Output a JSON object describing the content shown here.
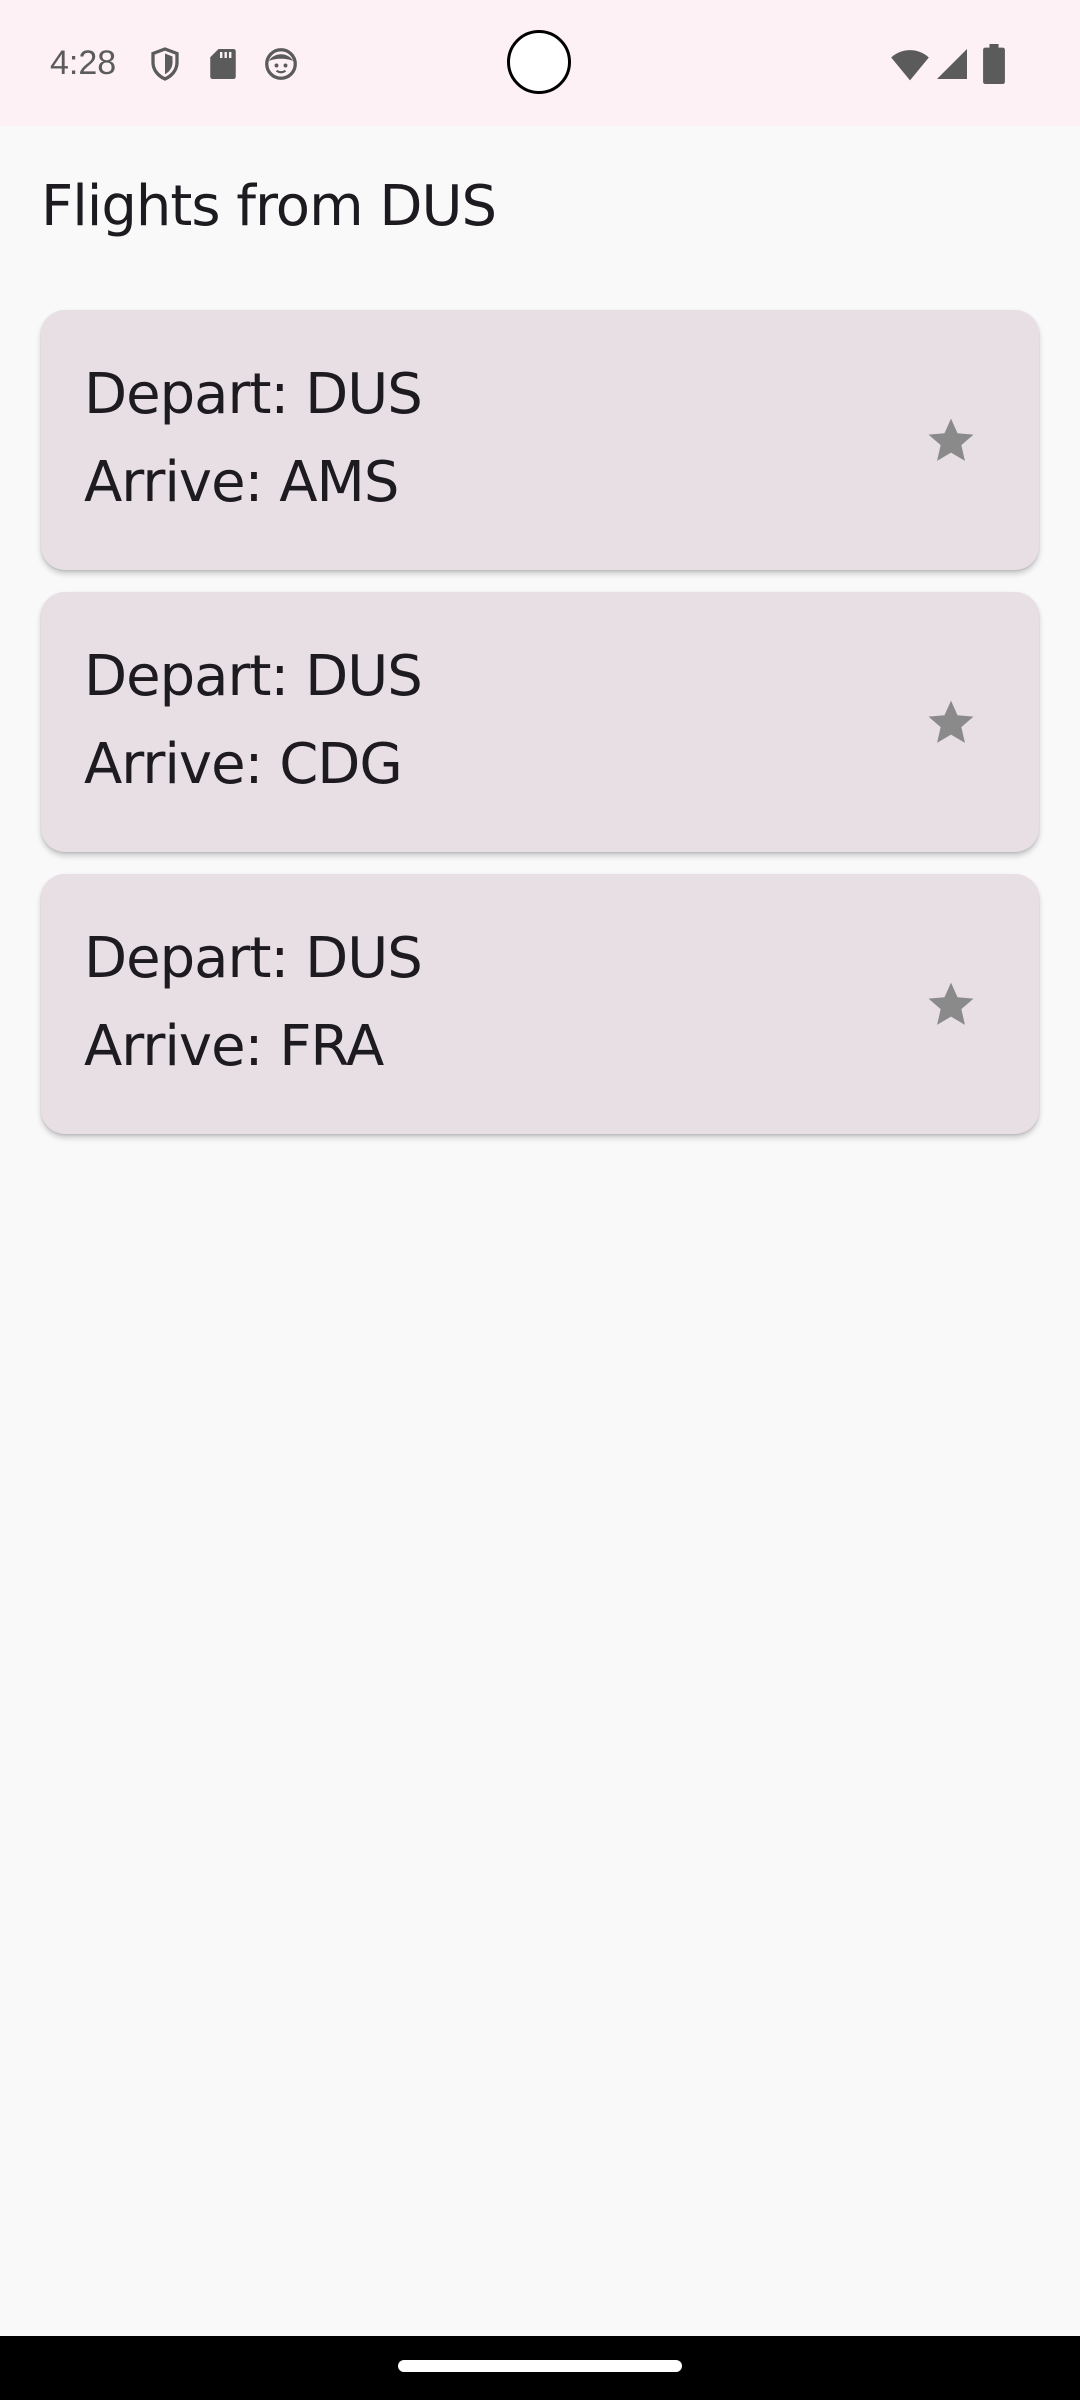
{
  "status_bar": {
    "time": "4:28",
    "icons_left": [
      "shield-icon",
      "sd-card-icon",
      "face-icon"
    ],
    "icons_right": [
      "wifi-icon",
      "cell-signal-icon",
      "battery-icon"
    ]
  },
  "page": {
    "title": "Flights from DUS"
  },
  "flights": [
    {
      "depart": "Depart: DUS",
      "arrive": "Arrive: AMS",
      "favorite_icon": "star-icon"
    },
    {
      "depart": "Depart: DUS",
      "arrive": "Arrive: CDG",
      "favorite_icon": "star-icon"
    },
    {
      "depart": "Depart: DUS",
      "arrive": "Arrive: FRA",
      "favorite_icon": "star-icon"
    }
  ],
  "colors": {
    "status_bar_bg": "#fdf1f6",
    "page_bg": "#f9f9f9",
    "card_bg": "#e8dfe5",
    "text": "#1d1b20",
    "star": "#8a8a8a"
  }
}
